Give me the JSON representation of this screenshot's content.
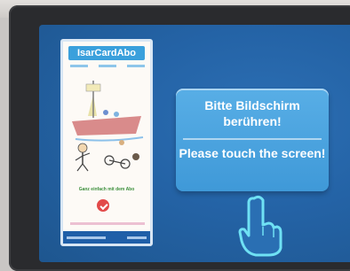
{
  "ad": {
    "title": "IsarCardAbo",
    "link_text": "Ganz einfach mit dem Abo"
  },
  "prompt": {
    "german": "Bitte Bildschirm berühren!",
    "english": "Please touch the screen!"
  },
  "icons": {
    "touch": "pointing-hand-icon",
    "badge": "checkmark-badge-icon"
  },
  "colors": {
    "screen": "#2463a6",
    "panel": "#4aa3de",
    "ad_title": "#3aa0dc",
    "bezel": "#2a2b2e"
  }
}
